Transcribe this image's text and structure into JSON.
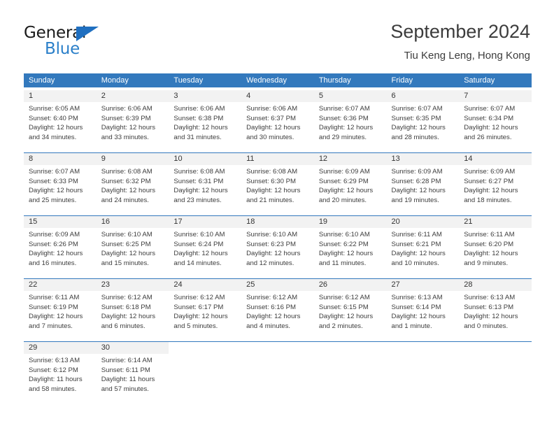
{
  "brand": {
    "name_part1": "General",
    "name_part2": "Blue",
    "triangle_color": "#1f6fc0",
    "blue_color": "#2a7fc9"
  },
  "header": {
    "title": "September 2024",
    "subtitle": "Tiu Keng Leng, Hong Kong"
  },
  "theme": {
    "header_blue": "#3379bd",
    "daynum_band": "#f2f2f2",
    "text": "#3d3d3d"
  },
  "weekdays": [
    "Sunday",
    "Monday",
    "Tuesday",
    "Wednesday",
    "Thursday",
    "Friday",
    "Saturday"
  ],
  "weeks": [
    [
      {
        "day": "1",
        "sunrise": "Sunrise: 6:05 AM",
        "sunset": "Sunset: 6:40 PM",
        "daylight_line1": "Daylight: 12 hours",
        "daylight_line2": "and 34 minutes."
      },
      {
        "day": "2",
        "sunrise": "Sunrise: 6:06 AM",
        "sunset": "Sunset: 6:39 PM",
        "daylight_line1": "Daylight: 12 hours",
        "daylight_line2": "and 33 minutes."
      },
      {
        "day": "3",
        "sunrise": "Sunrise: 6:06 AM",
        "sunset": "Sunset: 6:38 PM",
        "daylight_line1": "Daylight: 12 hours",
        "daylight_line2": "and 31 minutes."
      },
      {
        "day": "4",
        "sunrise": "Sunrise: 6:06 AM",
        "sunset": "Sunset: 6:37 PM",
        "daylight_line1": "Daylight: 12 hours",
        "daylight_line2": "and 30 minutes."
      },
      {
        "day": "5",
        "sunrise": "Sunrise: 6:07 AM",
        "sunset": "Sunset: 6:36 PM",
        "daylight_line1": "Daylight: 12 hours",
        "daylight_line2": "and 29 minutes."
      },
      {
        "day": "6",
        "sunrise": "Sunrise: 6:07 AM",
        "sunset": "Sunset: 6:35 PM",
        "daylight_line1": "Daylight: 12 hours",
        "daylight_line2": "and 28 minutes."
      },
      {
        "day": "7",
        "sunrise": "Sunrise: 6:07 AM",
        "sunset": "Sunset: 6:34 PM",
        "daylight_line1": "Daylight: 12 hours",
        "daylight_line2": "and 26 minutes."
      }
    ],
    [
      {
        "day": "8",
        "sunrise": "Sunrise: 6:07 AM",
        "sunset": "Sunset: 6:33 PM",
        "daylight_line1": "Daylight: 12 hours",
        "daylight_line2": "and 25 minutes."
      },
      {
        "day": "9",
        "sunrise": "Sunrise: 6:08 AM",
        "sunset": "Sunset: 6:32 PM",
        "daylight_line1": "Daylight: 12 hours",
        "daylight_line2": "and 24 minutes."
      },
      {
        "day": "10",
        "sunrise": "Sunrise: 6:08 AM",
        "sunset": "Sunset: 6:31 PM",
        "daylight_line1": "Daylight: 12 hours",
        "daylight_line2": "and 23 minutes."
      },
      {
        "day": "11",
        "sunrise": "Sunrise: 6:08 AM",
        "sunset": "Sunset: 6:30 PM",
        "daylight_line1": "Daylight: 12 hours",
        "daylight_line2": "and 21 minutes."
      },
      {
        "day": "12",
        "sunrise": "Sunrise: 6:09 AM",
        "sunset": "Sunset: 6:29 PM",
        "daylight_line1": "Daylight: 12 hours",
        "daylight_line2": "and 20 minutes."
      },
      {
        "day": "13",
        "sunrise": "Sunrise: 6:09 AM",
        "sunset": "Sunset: 6:28 PM",
        "daylight_line1": "Daylight: 12 hours",
        "daylight_line2": "and 19 minutes."
      },
      {
        "day": "14",
        "sunrise": "Sunrise: 6:09 AM",
        "sunset": "Sunset: 6:27 PM",
        "daylight_line1": "Daylight: 12 hours",
        "daylight_line2": "and 18 minutes."
      }
    ],
    [
      {
        "day": "15",
        "sunrise": "Sunrise: 6:09 AM",
        "sunset": "Sunset: 6:26 PM",
        "daylight_line1": "Daylight: 12 hours",
        "daylight_line2": "and 16 minutes."
      },
      {
        "day": "16",
        "sunrise": "Sunrise: 6:10 AM",
        "sunset": "Sunset: 6:25 PM",
        "daylight_line1": "Daylight: 12 hours",
        "daylight_line2": "and 15 minutes."
      },
      {
        "day": "17",
        "sunrise": "Sunrise: 6:10 AM",
        "sunset": "Sunset: 6:24 PM",
        "daylight_line1": "Daylight: 12 hours",
        "daylight_line2": "and 14 minutes."
      },
      {
        "day": "18",
        "sunrise": "Sunrise: 6:10 AM",
        "sunset": "Sunset: 6:23 PM",
        "daylight_line1": "Daylight: 12 hours",
        "daylight_line2": "and 12 minutes."
      },
      {
        "day": "19",
        "sunrise": "Sunrise: 6:10 AM",
        "sunset": "Sunset: 6:22 PM",
        "daylight_line1": "Daylight: 12 hours",
        "daylight_line2": "and 11 minutes."
      },
      {
        "day": "20",
        "sunrise": "Sunrise: 6:11 AM",
        "sunset": "Sunset: 6:21 PM",
        "daylight_line1": "Daylight: 12 hours",
        "daylight_line2": "and 10 minutes."
      },
      {
        "day": "21",
        "sunrise": "Sunrise: 6:11 AM",
        "sunset": "Sunset: 6:20 PM",
        "daylight_line1": "Daylight: 12 hours",
        "daylight_line2": "and 9 minutes."
      }
    ],
    [
      {
        "day": "22",
        "sunrise": "Sunrise: 6:11 AM",
        "sunset": "Sunset: 6:19 PM",
        "daylight_line1": "Daylight: 12 hours",
        "daylight_line2": "and 7 minutes."
      },
      {
        "day": "23",
        "sunrise": "Sunrise: 6:12 AM",
        "sunset": "Sunset: 6:18 PM",
        "daylight_line1": "Daylight: 12 hours",
        "daylight_line2": "and 6 minutes."
      },
      {
        "day": "24",
        "sunrise": "Sunrise: 6:12 AM",
        "sunset": "Sunset: 6:17 PM",
        "daylight_line1": "Daylight: 12 hours",
        "daylight_line2": "and 5 minutes."
      },
      {
        "day": "25",
        "sunrise": "Sunrise: 6:12 AM",
        "sunset": "Sunset: 6:16 PM",
        "daylight_line1": "Daylight: 12 hours",
        "daylight_line2": "and 4 minutes."
      },
      {
        "day": "26",
        "sunrise": "Sunrise: 6:12 AM",
        "sunset": "Sunset: 6:15 PM",
        "daylight_line1": "Daylight: 12 hours",
        "daylight_line2": "and 2 minutes."
      },
      {
        "day": "27",
        "sunrise": "Sunrise: 6:13 AM",
        "sunset": "Sunset: 6:14 PM",
        "daylight_line1": "Daylight: 12 hours",
        "daylight_line2": "and 1 minute."
      },
      {
        "day": "28",
        "sunrise": "Sunrise: 6:13 AM",
        "sunset": "Sunset: 6:13 PM",
        "daylight_line1": "Daylight: 12 hours",
        "daylight_line2": "and 0 minutes."
      }
    ],
    [
      {
        "day": "29",
        "sunrise": "Sunrise: 6:13 AM",
        "sunset": "Sunset: 6:12 PM",
        "daylight_line1": "Daylight: 11 hours",
        "daylight_line2": "and 58 minutes."
      },
      {
        "day": "30",
        "sunrise": "Sunrise: 6:14 AM",
        "sunset": "Sunset: 6:11 PM",
        "daylight_line1": "Daylight: 11 hours",
        "daylight_line2": "and 57 minutes."
      },
      {
        "day": "",
        "sunrise": "",
        "sunset": "",
        "daylight_line1": "",
        "daylight_line2": ""
      },
      {
        "day": "",
        "sunrise": "",
        "sunset": "",
        "daylight_line1": "",
        "daylight_line2": ""
      },
      {
        "day": "",
        "sunrise": "",
        "sunset": "",
        "daylight_line1": "",
        "daylight_line2": ""
      },
      {
        "day": "",
        "sunrise": "",
        "sunset": "",
        "daylight_line1": "",
        "daylight_line2": ""
      },
      {
        "day": "",
        "sunrise": "",
        "sunset": "",
        "daylight_line1": "",
        "daylight_line2": ""
      }
    ]
  ]
}
